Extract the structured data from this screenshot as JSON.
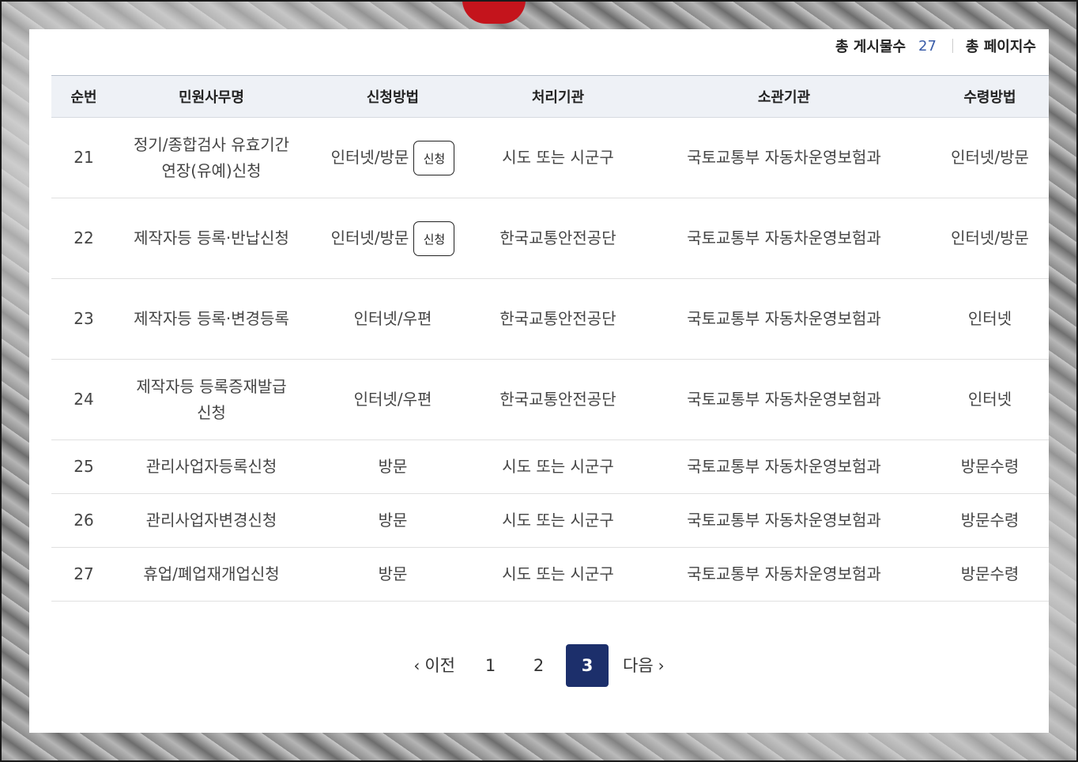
{
  "summary": {
    "total_posts_label": "총 게시물수",
    "total_posts_value": "27",
    "total_pages_label": "총 페이지수"
  },
  "table": {
    "headers": [
      "순번",
      "민원사무명",
      "신청방법",
      "처리기관",
      "소관기관",
      "수령방법"
    ],
    "apply_button_label": "신청",
    "rows": [
      {
        "no": "21",
        "name": "정기/종합검사 유효기간 연장(유예)신청",
        "method": "인터넷/방문",
        "processor": "시도 또는 시군구",
        "dept": "국토교통부 자동차운영보험과",
        "receipt": "인터넷/방문"
      },
      {
        "no": "22",
        "name": "제작자등 등록·반납신청",
        "method": "인터넷/방문",
        "processor": "한국교통안전공단",
        "dept": "국토교통부 자동차운영보험과",
        "receipt": "인터넷/방문"
      },
      {
        "no": "23",
        "name": "제작자등 등록·변경등록",
        "method": "인터넷/우편",
        "processor": "한국교통안전공단",
        "dept": "국토교통부 자동차운영보험과",
        "receipt": "인터넷"
      },
      {
        "no": "24",
        "name": "제작자등 등록증재발급 신청",
        "method": "인터넷/우편",
        "processor": "한국교통안전공단",
        "dept": "국토교통부 자동차운영보험과",
        "receipt": "인터넷"
      },
      {
        "no": "25",
        "name": "관리사업자등록신청",
        "method": "방문",
        "processor": "시도 또는 시군구",
        "dept": "국토교통부 자동차운영보험과",
        "receipt": "방문수령"
      },
      {
        "no": "26",
        "name": "관리사업자변경신청",
        "method": "방문",
        "processor": "시도 또는 시군구",
        "dept": "국토교통부 자동차운영보험과",
        "receipt": "방문수령"
      },
      {
        "no": "27",
        "name": "휴업/폐업재개업신청",
        "method": "방문",
        "processor": "시도 또는 시군구",
        "dept": "국토교통부 자동차운영보험과",
        "receipt": "방문수령"
      }
    ]
  },
  "pagination": {
    "prev_label": "이전",
    "next_label": "다음",
    "pages": [
      "1",
      "2",
      "3"
    ],
    "current": "3"
  },
  "icons": {
    "prev": "chevron-left-icon",
    "next": "chevron-right-icon"
  }
}
